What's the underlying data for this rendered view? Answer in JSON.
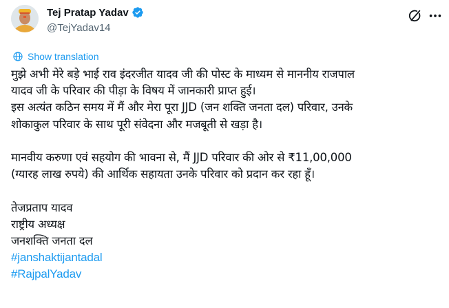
{
  "author": {
    "display_name": "Tej Pratap Yadav",
    "handle": "@TejYadav14",
    "verified": true,
    "avatar_icon": "profile-photo"
  },
  "header_icons": {
    "grok": "grok-icon",
    "more": "more-options-icon"
  },
  "translate_label": "Show translation",
  "post_lines": [
    "मुझे अभी मेरे बड़े भाई राव इंदरजीत यादव जी की पोस्ट के माध्यम से माननीय राजपाल",
    "यादव जी के परिवार की पीड़ा के विषय में जानकारी प्राप्त हुई।",
    "इस अत्यंत कठिन समय में मैं और मेरा पूरा JJD (जन शक्ति जनता दल) परिवार, उनके",
    "शोकाकुल परिवार के साथ पूरी संवेदना और मजबूती से खड़ा है।",
    "",
    "मानवीय करुणा एवं सहयोग की भावना से, मैं JJD परिवार की ओर से ₹11,00,000",
    "(ग्यारह लाख रुपये) की आर्थिक सहायता उनके परिवार को प्रदान कर रहा हूँ।",
    "",
    "तेजप्रताप यादव",
    "राष्ट्रीय अध्यक्ष",
    "जनशक्ति जनता दल"
  ],
  "hashtags": [
    "#janshaktijantadal",
    "#RajpalYadav"
  ],
  "colors": {
    "link": "#1d9bf0",
    "text": "#0f1419",
    "secondary": "#536471"
  }
}
